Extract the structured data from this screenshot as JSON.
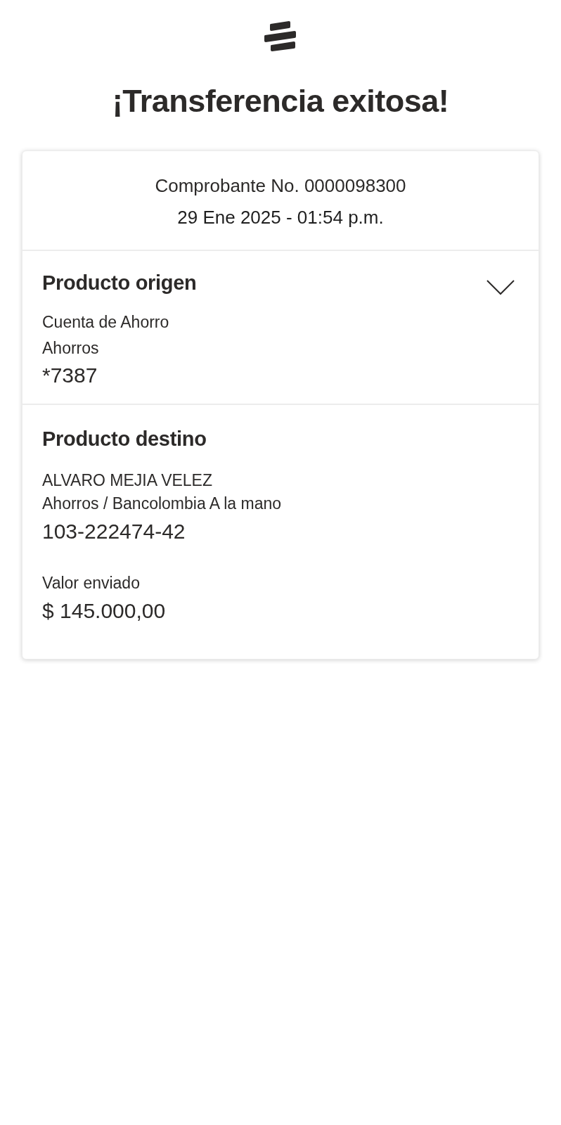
{
  "title": "¡Transferencia exitosa!",
  "receipt": {
    "number": "Comprobante No. 0000098300",
    "datetime": "29 Ene 2025 - 01:54 p.m."
  },
  "sections": [
    {
      "title": "Producto origen",
      "collapsible": true,
      "lines": [
        "Cuenta de Ahorro",
        "Ahorros"
      ],
      "account": "*7387"
    },
    {
      "title": "Producto destino",
      "collapsible": false,
      "lines": [
        "ALVARO MEJIA VELEZ",
        "Ahorros / Bancolombia A la mano"
      ],
      "account": "103-222474-42",
      "amount": {
        "label": "Valor enviado",
        "value": "$ 145.000,00"
      }
    }
  ]
}
